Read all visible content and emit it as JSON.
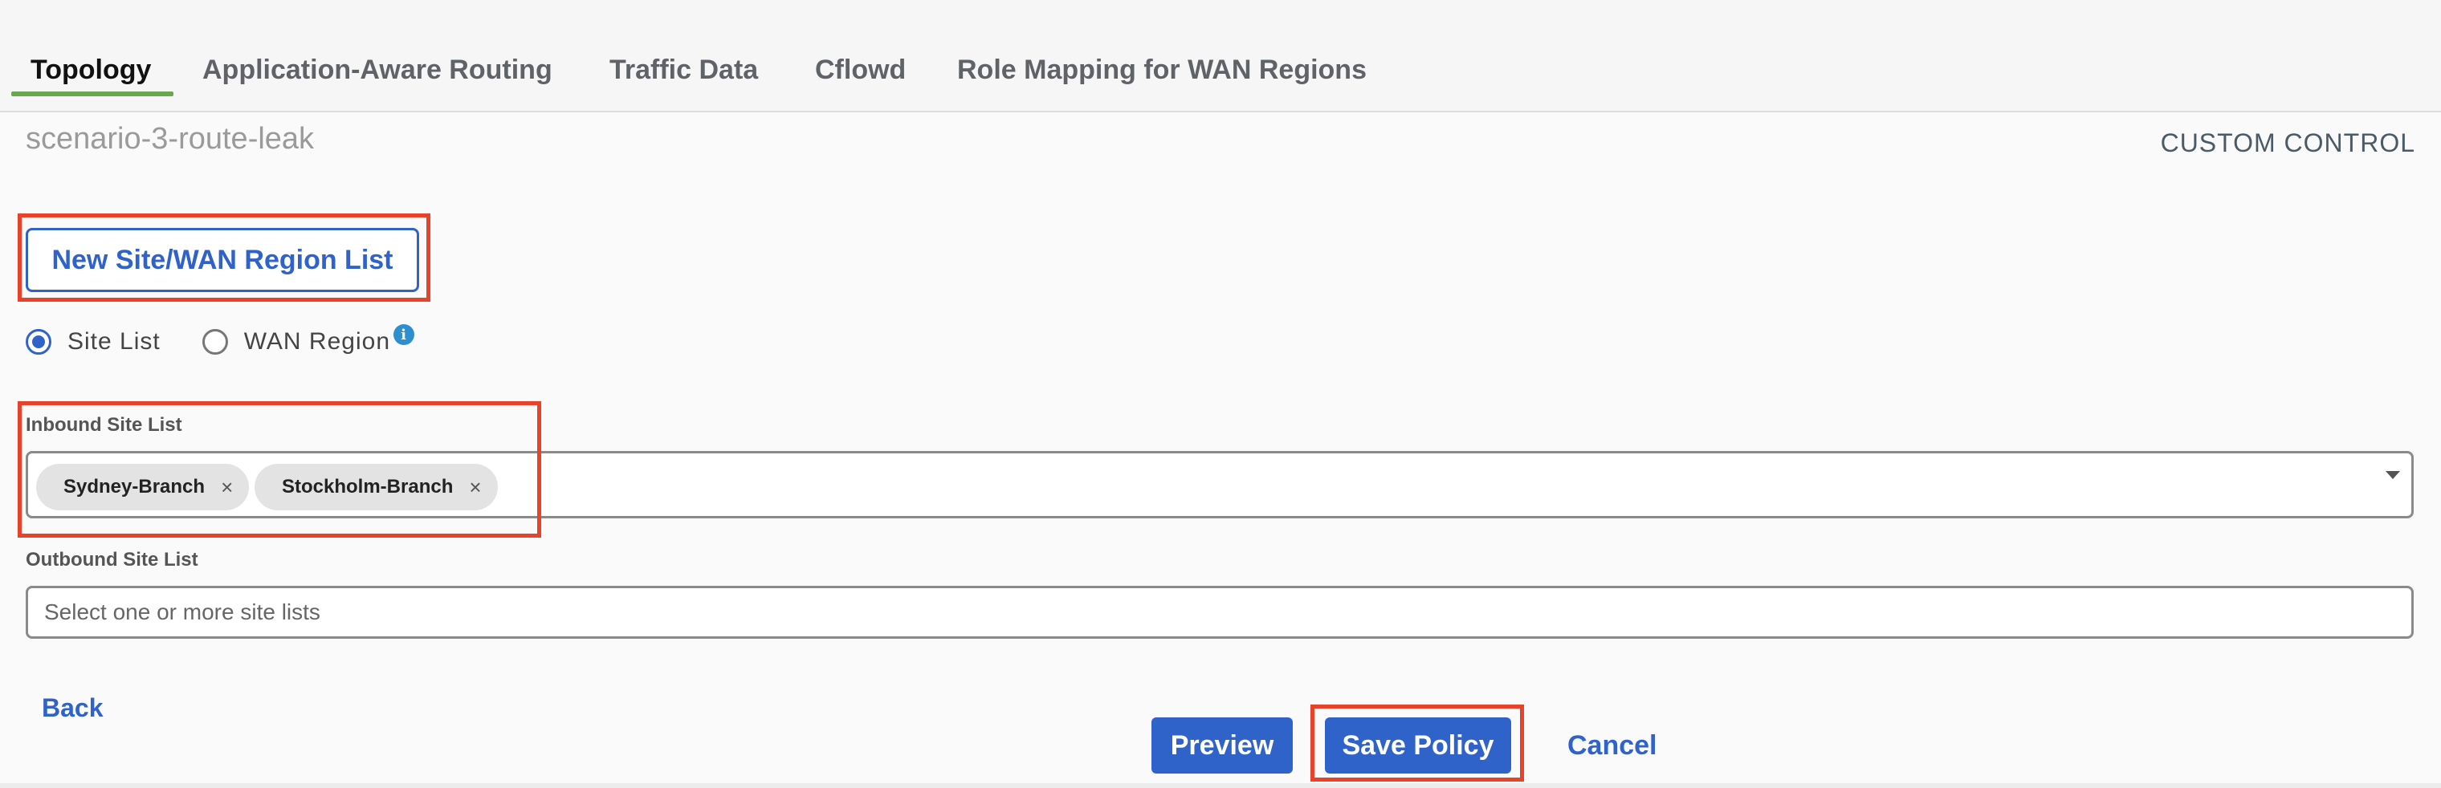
{
  "tabs": [
    {
      "label": "Topology",
      "active": true
    },
    {
      "label": "Application-Aware Routing"
    },
    {
      "label": "Traffic Data"
    },
    {
      "label": "Cflowd"
    },
    {
      "label": "Role Mapping for WAN Regions"
    }
  ],
  "policy_name": "scenario-3-route-leak",
  "custom_control_label": "CUSTOM CONTROL",
  "new_list_button": "New Site/WAN Region List",
  "radio_options": [
    {
      "label": "Site List",
      "checked": true
    },
    {
      "label": "WAN Region",
      "checked": false
    }
  ],
  "inbound": {
    "label": "Inbound Site List",
    "chips": [
      "Sydney-Branch",
      "Stockholm-Branch"
    ]
  },
  "outbound": {
    "label": "Outbound Site List",
    "placeholder": "Select one or more site lists"
  },
  "footer": {
    "back": "Back",
    "preview": "Preview",
    "save": "Save Policy",
    "cancel": "Cancel"
  },
  "colors": {
    "accent": "#2f63c9",
    "tab_underline": "#6aa84f",
    "highlight": "#e8432a"
  },
  "icons": {
    "info": "info-icon",
    "chip_remove": "close-icon",
    "dropdown": "chevron-down-icon"
  }
}
